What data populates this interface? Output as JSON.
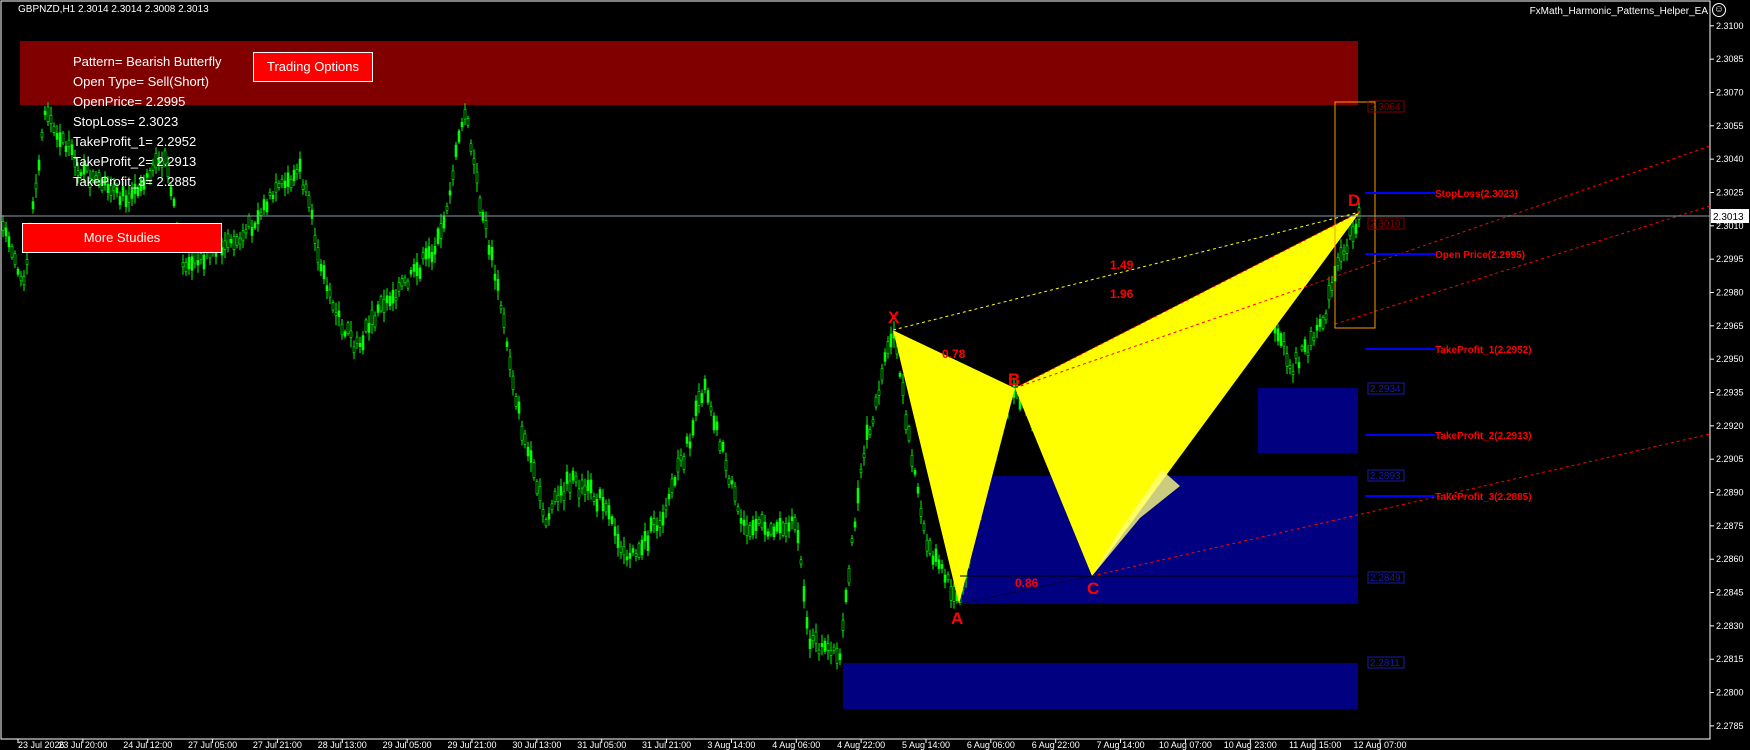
{
  "header": {
    "symbol": "GBPNZD,H1  2.3014 2.3014 2.3008 2.3013",
    "ea_name": "FxMath_Harmonic_Patterns_Helper_EA",
    "smiley": "☺"
  },
  "info": {
    "pattern": "Pattern= Bearish Butterfly",
    "open_type": "Open Type= Sell(Short)",
    "open_price": "OpenPrice= 2.2995",
    "stop_loss": "StopLoss= 2.3023",
    "tp1": "TakeProfit_1= 2.2952",
    "tp2": "TakeProfit_2= 2.2913",
    "tp3": "TakeProfit_3= 2.2885"
  },
  "buttons": {
    "trading_options": "Trading Options",
    "more_studies": "More Studies"
  },
  "pattern": {
    "points": {
      "X": "X",
      "A": "A",
      "B": "B",
      "C": "C",
      "D": "D"
    },
    "ratios": {
      "xb": "0.78",
      "ac": "0.86",
      "xd": "1.49",
      "bd": "1.96"
    }
  },
  "levels": {
    "stop_loss": "StopLoss(2.3023)",
    "open_price": "Open Price(2.2995)",
    "tp1": "TakeProfit_1(2.2952)",
    "tp2": "TakeProfit_2(2.2913)",
    "tp3": "TakeProfit_3(2.2885)"
  },
  "price_axis": {
    "ticks": [
      "2.3100",
      "2.3085",
      "2.3070",
      "2.3055",
      "2.3040",
      "2.3025",
      "2.3010",
      "2.2995",
      "2.2980",
      "2.2965",
      "2.2950",
      "2.2935",
      "2.2920",
      "2.2905",
      "2.2890",
      "2.2875",
      "2.2860",
      "2.2845",
      "2.2830",
      "2.2815",
      "2.2800",
      "2.2785"
    ],
    "current": "2.3013",
    "min": 2.278,
    "max": 2.3108
  },
  "time_axis": {
    "ticks": [
      "23 Jul 2026",
      "23 Jul 20:00",
      "24 Jul 12:00",
      "27 Jul 05:00",
      "27 Jul 21:00",
      "28 Jul 13:00",
      "29 Jul 05:00",
      "29 Jul 21:00",
      "30 Jul 13:00",
      "31 Jul 05:00",
      "31 Jul 21:00",
      "3 Aug 14:00",
      "4 Aug 06:00",
      "4 Aug 22:00",
      "5 Aug 14:00",
      "6 Aug 06:00",
      "6 Aug 22:00",
      "7 Aug 14:00",
      "10 Aug 07:00",
      "10 Aug 23:00",
      "11 Aug 15:00",
      "12 Aug 07:00"
    ]
  },
  "zone_labels": {
    "top": "2.3064",
    "mid": "2.3010",
    "z1": "2.2934",
    "z2": "2.2893",
    "z3": "2.2849",
    "z4": "2.2811"
  },
  "colors": {
    "candle": "#00ff00",
    "pattern_fill": "#ffff00",
    "sell_zone": "#800000",
    "tp_zone": "#000080",
    "level_line": "#0000ff",
    "level_text": "#ff0000",
    "point_label": "#ff0000"
  }
}
